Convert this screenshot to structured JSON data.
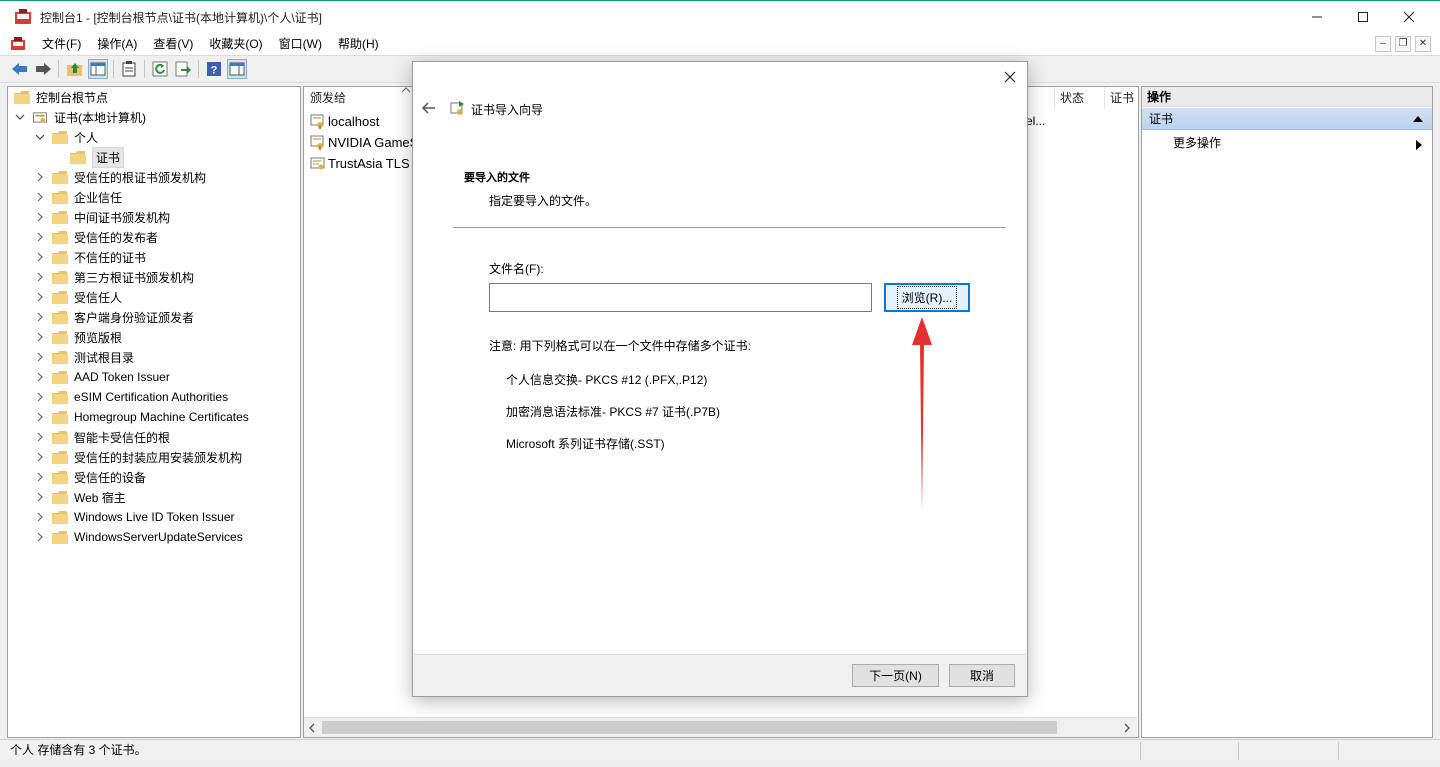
{
  "window": {
    "title": "控制台1 - [控制台根节点\\证书(本地计算机)\\个人\\证书]",
    "minimize": "—",
    "maximize": "☐",
    "close": "✕"
  },
  "menu": {
    "items": [
      "文件(F)",
      "操作(A)",
      "查看(V)",
      "收藏夹(O)",
      "窗口(W)",
      "帮助(H)"
    ],
    "mdi_min": "–",
    "mdi_restore": "❐",
    "mdi_close": "✕"
  },
  "tree": {
    "root": "控制台根节点",
    "store": "证书(本地计算机)",
    "personal": "个人",
    "cert": "证书",
    "folders": [
      "受信任的根证书颁发机构",
      "企业信任",
      "中间证书颁发机构",
      "受信任的发布者",
      "不信任的证书",
      "第三方根证书颁发机构",
      "受信任人",
      "客户端身份验证颁发者",
      "预览版根",
      "测试根目录",
      "AAD Token Issuer",
      "eSIM Certification Authorities",
      "Homegroup Machine Certificates",
      "智能卡受信任的根",
      "受信任的封装应用安装颁发机构",
      "受信任的设备",
      "Web 宿主",
      "Windows Live ID Token Issuer",
      "WindowsServerUpdateServices"
    ]
  },
  "list": {
    "columns": {
      "issued_to": "颁发给",
      "status": "状态",
      "cert": "证书"
    },
    "rows": [
      "localhost",
      "NVIDIA GameS",
      "TrustAsia TLS R"
    ],
    "overflow_text": "el..."
  },
  "actions": {
    "header": "操作",
    "group": "证书",
    "more": "更多操作"
  },
  "status": {
    "text": "个人 存储含有 3 个证书。"
  },
  "dialog": {
    "title": "证书导入向导",
    "heading": "要导入的文件",
    "subheading": "指定要导入的文件。",
    "file_label": "文件名(F):",
    "file_value": "",
    "browse": "浏览(R)...",
    "note": "注意: 用下列格式可以在一个文件中存储多个证书:",
    "formats": [
      "个人信息交换- PKCS #12 (.PFX,.P12)",
      "加密消息语法标准- PKCS #7 证书(.P7B)",
      "Microsoft 系列证书存储(.SST)"
    ],
    "next": "下一页(N)",
    "cancel": "取消"
  },
  "colors": {
    "accent": "#0078d7",
    "annotation_arrow": "#e53030",
    "folder": "#e8c36a"
  }
}
